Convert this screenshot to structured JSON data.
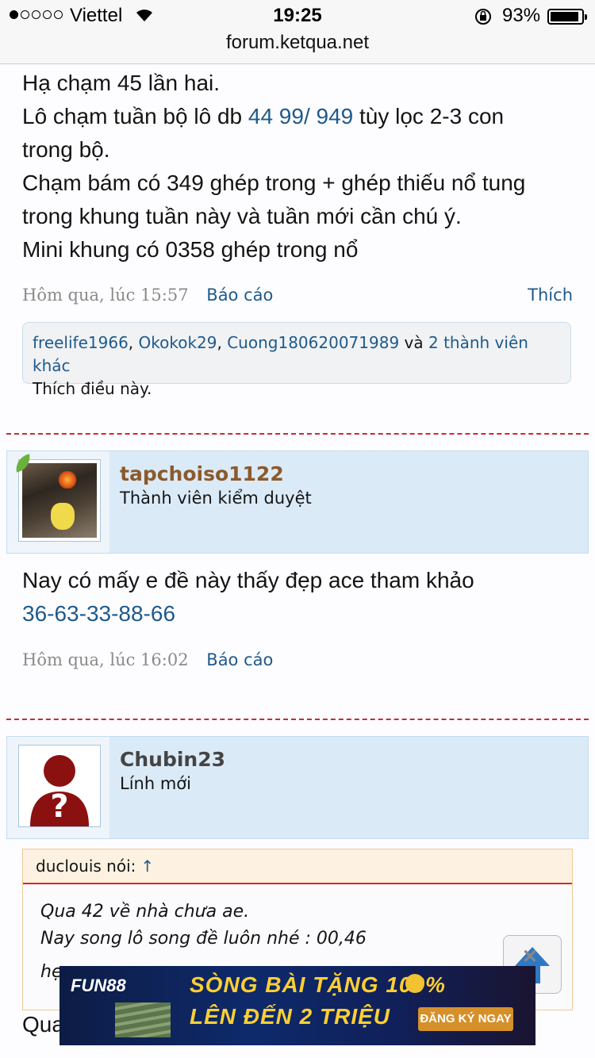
{
  "status_bar": {
    "carrier": "Viettel",
    "time": "19:25",
    "battery_pct": "93%",
    "battery_level": 0.93,
    "url": "forum.ketqua.net"
  },
  "post1": {
    "line1": "Hạ chạm 45 lần hai.",
    "line2_pre": "Lô chạm tuần bộ lô db ",
    "line2_link": "44 99/ 949",
    "line2_post": " tùy lọc 2-3 con",
    "line3": "trong bộ.",
    "line4": "Chạm bám có 349 ghép trong + ghép thiếu nổ tung",
    "line5": "trong khung tuần này và tuần mới cần chú ý.",
    "line6": "Mini khung có 0358 ghép trong nổ",
    "time": "Hôm qua, lúc 15:57",
    "report": "Báo cáo",
    "like": "Thích",
    "likes": {
      "user1": "freelife1966",
      "user2": "Okokok29",
      "user3": "Cuong180620071989",
      "and": "và",
      "others": "2 thành viên khác",
      "suffix": "Thích điều này."
    }
  },
  "post2": {
    "username": "tapchoiso1122",
    "username_color": "#8b5a2b",
    "role": "Thành viên kiểm duyệt",
    "text": "Nay có mấy e đề này thấy đẹp ace tham khảo",
    "link": "36-63-33-88-66",
    "time": "Hôm qua, lúc 16:02",
    "report": "Báo cáo"
  },
  "post3": {
    "username": "Chubin23",
    "username_color": "#444444",
    "role": "Lính mới",
    "quote_author": "duclouis nói:",
    "quote_arrow": "↑",
    "quote_line1": "Qua 42 về nhà chưa ae.",
    "quote_line2": "Nay song lô song đề luôn nhé : 00,46",
    "quote_line3": "hẹ",
    "body_start": "Qua"
  },
  "ad": {
    "brand": "FUN88",
    "line1": "SÒNG BÀI TẶNG 100%",
    "line2": "LÊN ĐẾN 2 TRIỆU",
    "cta": "ĐĂNG KÝ NGAY"
  },
  "colors": {
    "link": "#1e5a8c",
    "divider": "#cc2a2a",
    "user_bar": "#dbeaf7"
  }
}
